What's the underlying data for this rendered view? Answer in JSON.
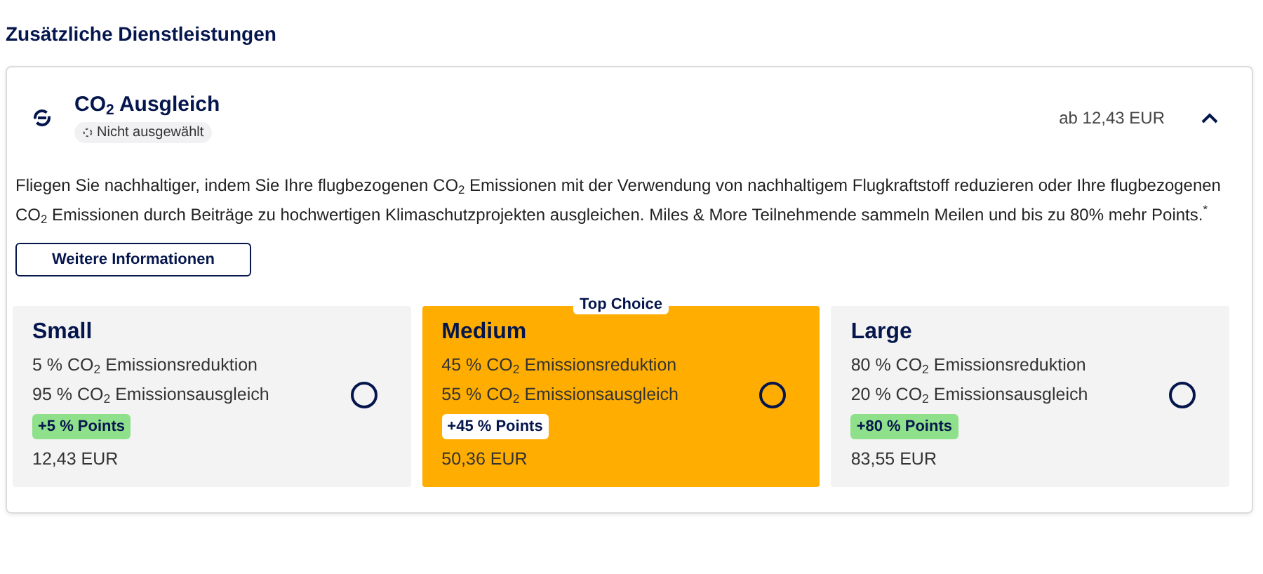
{
  "section_title": "Zusätzliche Dienstleistungen",
  "service": {
    "title": "CO$_{2}$ Ausgleich",
    "status": "Nicht ausgewählt",
    "price": "ab 12,43 EUR",
    "expanded": true,
    "description": "Fliegen Sie nachhaltiger, indem Sie Ihre flugbezogenen CO$_{2}$ Emissionen mit der Verwendung von nachhaltigem Flugkraftstoff reduzieren oder Ihre flugbezogenen CO$_{2}$ Emissionen durch Beiträge zu hochwertigen Klimaschutzprojekten ausgleichen. Miles & More Teilnehmende sammeln Meilen und bis zu 80% mehr Points.$^{*}$",
    "more_button": "Weitere Informationen",
    "options": [
      {
        "name": "Small",
        "reduction": "5 % CO$_{2}$ Emissionsreduktion",
        "offset": "95 % CO$_{2}$ Emissionsausgleich",
        "points": "+5 % Points",
        "price": "12,43 EUR",
        "highlighted": false,
        "selected": false
      },
      {
        "name": "Medium",
        "badge": "Top Choice",
        "reduction": "45 % CO$_{2}$ Emissionsreduktion",
        "offset": "55 % CO$_{2}$ Emissionsausgleich",
        "points": "+45 % Points",
        "price": "50,36 EUR",
        "highlighted": true,
        "selected": false
      },
      {
        "name": "Large",
        "reduction": "80 % CO$_{2}$ Emissionsreduktion",
        "offset": "20 % CO$_{2}$ Emissionsausgleich",
        "points": "+80 % Points",
        "price": "83,55 EUR",
        "highlighted": false,
        "selected": false
      }
    ]
  }
}
